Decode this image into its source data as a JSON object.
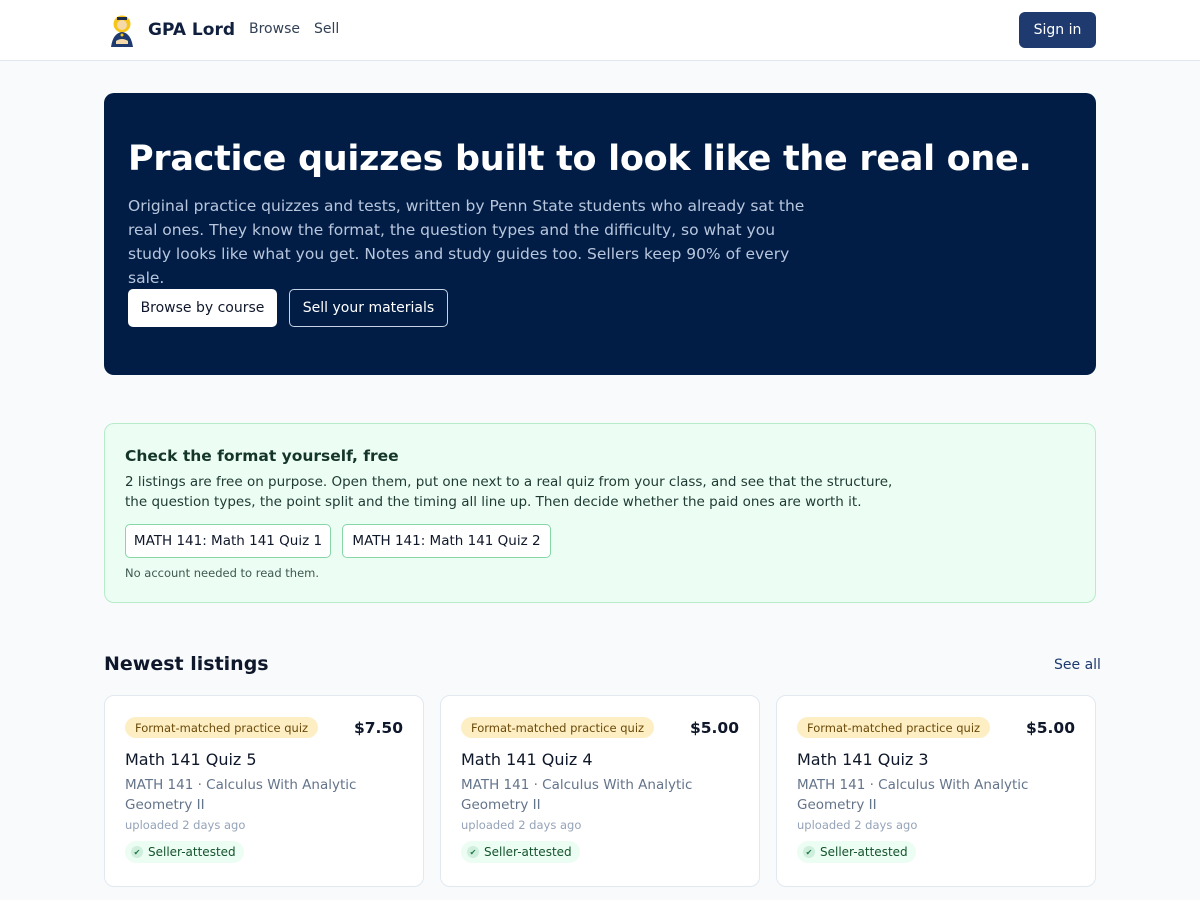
{
  "header": {
    "brand": "GPA Lord",
    "logo_icon": "buddha-graduate-logo",
    "nav": [
      "Browse",
      "Sell"
    ],
    "signin_label": "Sign in"
  },
  "hero": {
    "title": "Practice quizzes built to look like the real one.",
    "description": "Original practice quizzes and tests, written by Penn State students who already sat the real ones. They know the format, the question types and the difficulty, so what you study looks like what you get. Notes and study guides too. Sellers keep 90% of every sale.",
    "primary_button": "Browse by course",
    "secondary_button": "Sell your materials"
  },
  "free": {
    "title": "Check the format yourself, free",
    "description": "2 listings are free on purpose. Open them, put one next to a real quiz from your class, and see that the structure, the question types, the point split and the timing all line up. Then decide whether the paid ones are worth it.",
    "chips": [
      "MATH 141: Math 141 Quiz 1",
      "MATH 141: Math 141 Quiz 2"
    ],
    "note": "No account needed to read them."
  },
  "newest": {
    "title": "Newest listings",
    "see_all": "See all",
    "cards": [
      {
        "badge": "Format-matched practice quiz",
        "price": "$7.50",
        "title": "Math 141 Quiz 5",
        "course": "MATH 141 · Calculus With Analytic Geometry II",
        "uploaded": "uploaded 2 days ago",
        "attest": "Seller-attested"
      },
      {
        "badge": "Format-matched practice quiz",
        "price": "$5.00",
        "title": "Math 141 Quiz 4",
        "course": "MATH 141 · Calculus With Analytic Geometry II",
        "uploaded": "uploaded 2 days ago",
        "attest": "Seller-attested"
      },
      {
        "badge": "Format-matched practice quiz",
        "price": "$5.00",
        "title": "Math 141 Quiz 3",
        "course": "MATH 141 · Calculus With Analytic Geometry II",
        "uploaded": "uploaded 2 days ago",
        "attest": "Seller-attested"
      }
    ]
  },
  "colors": {
    "hero_bg": "#021d45",
    "accent": "#1e3a6e",
    "free_bg": "#ecfdf3",
    "badge_bg": "#fdeec3"
  }
}
